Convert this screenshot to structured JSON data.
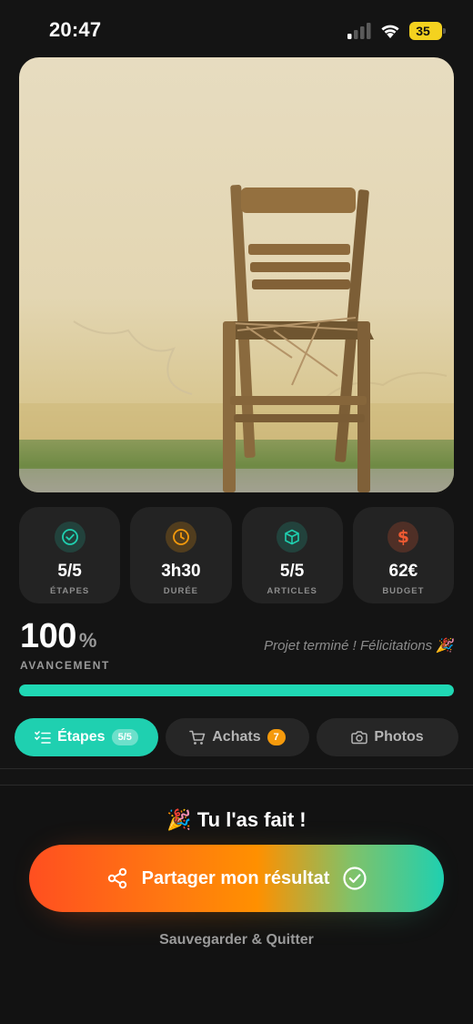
{
  "status_bar": {
    "time": "20:47",
    "battery": "35",
    "battery_level": 0.35
  },
  "hero": {
    "subject": "old wooden chair against wall"
  },
  "stats": [
    {
      "value": "5/5",
      "label": "ÉTAPES",
      "icon": "check-circle-icon",
      "color": "#1fd0b0"
    },
    {
      "value": "3h30",
      "label": "DURÉE",
      "icon": "clock-icon",
      "color": "#f59a0c"
    },
    {
      "value": "5/5",
      "label": "ARTICLES",
      "icon": "box-icon",
      "color": "#1fd0b0"
    },
    {
      "value": "62€",
      "label": "BUDGET",
      "icon": "dollar-icon",
      "color": "#ef5a32"
    }
  ],
  "progress": {
    "value": "100",
    "unit": "%",
    "label": "AVANCEMENT",
    "message": "Projet terminé ! Félicitations 🎉",
    "fraction": 1.0,
    "color": "#1fd8b4"
  },
  "tabs": [
    {
      "label": "Étapes",
      "badge": "5/5",
      "icon": "checklist-icon",
      "active": true
    },
    {
      "label": "Achats",
      "badge": "7",
      "icon": "cart-icon",
      "active": false
    },
    {
      "label": "Photos",
      "badge": "",
      "icon": "camera-icon",
      "active": false
    }
  ],
  "footer": {
    "congrats": "🎉 Tu l'as fait !",
    "share_label": "Partager mon résultat",
    "quit_label": "Sauvegarder & Quitter"
  },
  "colors": {
    "accent": "#1fd0b0",
    "orange": "#ff7a10",
    "background": "#141414"
  }
}
